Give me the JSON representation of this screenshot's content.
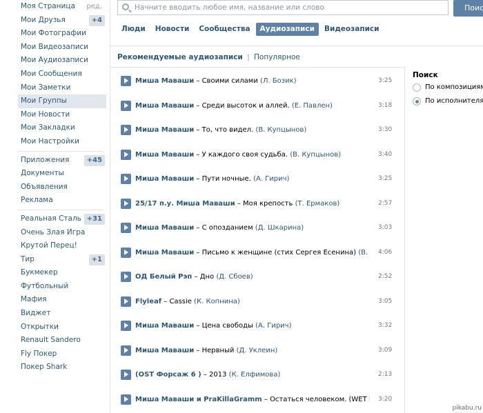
{
  "sidebar": {
    "group1": [
      {
        "label": "Моя Страница",
        "edit": "ред."
      },
      {
        "label": "Мои Друзья",
        "badge": "+4"
      },
      {
        "label": "Мои Фотографии"
      },
      {
        "label": "Мои Видеозаписи"
      },
      {
        "label": "Мои Аудиозаписи"
      },
      {
        "label": "Мои Сообщения"
      },
      {
        "label": "Мои Заметки"
      },
      {
        "label": "Мои Группы"
      },
      {
        "label": "Мои Новости"
      },
      {
        "label": "Мои Закладки"
      },
      {
        "label": "Мои Настройки"
      }
    ],
    "group2": [
      {
        "label": "Приложения",
        "badge": "+45"
      },
      {
        "label": "Документы"
      },
      {
        "label": "Объявления"
      },
      {
        "label": "Реклама"
      }
    ],
    "group3": [
      {
        "label": "Реальная Сталь",
        "badge": "+31"
      },
      {
        "label": "Очень Злая Игра"
      },
      {
        "label": "Крутой Перец!"
      },
      {
        "label": "Тир",
        "badge": "+1"
      },
      {
        "label": "Букмекер"
      },
      {
        "label": "Футбольный"
      },
      {
        "label": "Мафия"
      },
      {
        "label": "Виджет"
      },
      {
        "label": "Открытки"
      },
      {
        "label": "Renault Sandero"
      },
      {
        "label": "Fly Покер"
      },
      {
        "label": "Покер Shark"
      }
    ]
  },
  "search": {
    "placeholder": "Начните вводить любое имя, название или слово",
    "button_label": "Поиск"
  },
  "tabs": [
    {
      "label": "Люди"
    },
    {
      "label": "Новости"
    },
    {
      "label": "Сообщества"
    },
    {
      "label": "Аудиозаписи",
      "active": true
    },
    {
      "label": "Видеозаписи"
    }
  ],
  "subtabs": {
    "recommended": "Рекомендуемые аудиозаписи",
    "separator": "|",
    "popular": "Популярное"
  },
  "tracks": [
    {
      "artist": "Миша Маваши",
      "title": "Своими силами",
      "author": "(Л. Бозик)",
      "duration": "3:25"
    },
    {
      "artist": "Миша Маваши",
      "title": "Среди высоток и аллей.",
      "author": "(Е. Павлен)",
      "duration": "3:18"
    },
    {
      "artist": "Миша Маваши",
      "title": "То, что видел.",
      "author": "(В. Купцынов)",
      "duration": "3:30"
    },
    {
      "artist": "Миша Маваши",
      "title": "У каждого своя судьба.",
      "author": "(В. Купцынов)",
      "duration": "3:40"
    },
    {
      "artist": "Миша Маваши",
      "title": "Пути ночные.",
      "author": "(А. Гирич)",
      "duration": "3:25"
    },
    {
      "artist": "25/17 п.у. Миша Маваши",
      "title": "Моя крепость",
      "author": "(Т. Ермаков)",
      "duration": "2:57"
    },
    {
      "artist": "Миша Маваши",
      "title": "С опозданием",
      "author": "(Д. Шкарина)",
      "duration": "3:03"
    },
    {
      "artist": "Миша Маваши",
      "title": "Письмо к женщине (стих Сергея Есенина)",
      "author": "(В. Купц...",
      "duration": "4:06"
    },
    {
      "artist": "ОД Белый Рэп",
      "title": "Дно",
      "author": "(Д. Сбоев)",
      "duration": "2:52"
    },
    {
      "artist": "Flyleaf",
      "title": "Cassie",
      "author": "(К. Копнина)",
      "duration": "3:05"
    },
    {
      "artist": "Миша Маваши",
      "title": "Цена свободы",
      "author": "(А. Гирич)",
      "duration": "3:32"
    },
    {
      "artist": "Миша Маваши",
      "title": "Нервный",
      "author": "(Д. Уклеин)",
      "duration": "3:09"
    },
    {
      "artist": "(OST Форсаж 6 )",
      "title": "2013",
      "author": "(К. Елфимова)",
      "duration": "2:13"
    },
    {
      "artist": "Миша Маваши и PraKillaGramm",
      "title": "Остаться человеком. (WET Bea...",
      "author": "",
      "duration": "3:20"
    }
  ],
  "side_panel": {
    "title": "Поиск",
    "options": [
      {
        "label": "По композициям",
        "checked": false
      },
      {
        "label": "По исполнителям",
        "checked": true
      }
    ]
  },
  "watermark": "pikabu.ru",
  "colors": {
    "link": "#2b587a",
    "accent": "#5e81a8",
    "active_bg": "#e1e7ed",
    "badge_bg": "#dae2e8"
  }
}
